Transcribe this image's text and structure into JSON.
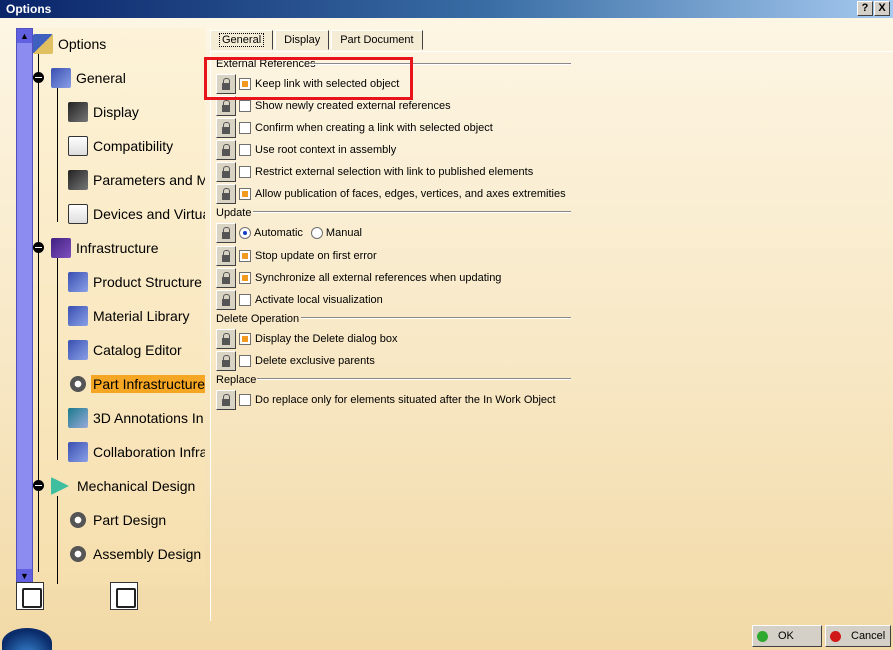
{
  "window": {
    "title": "Options",
    "help_label": "?",
    "close_label": "X"
  },
  "tree": {
    "items": [
      {
        "label": "Options",
        "icon": "options-icon"
      },
      {
        "label": "General",
        "icon": "general-icon"
      },
      {
        "label": "Display",
        "icon": "display-icon"
      },
      {
        "label": "Compatibility",
        "icon": "compatibility-icon"
      },
      {
        "label": "Parameters and Me",
        "icon": "parameters-icon"
      },
      {
        "label": "Devices and Virtua",
        "icon": "devices-icon"
      },
      {
        "label": "Infrastructure",
        "icon": "infrastructure-icon"
      },
      {
        "label": "Product Structure",
        "icon": "product-structure-icon"
      },
      {
        "label": "Material Library",
        "icon": "material-library-icon"
      },
      {
        "label": "Catalog Editor",
        "icon": "catalog-editor-icon"
      },
      {
        "label": "Part Infrastructure",
        "icon": "gear-icon"
      },
      {
        "label": "3D Annotations In",
        "icon": "annotations-icon"
      },
      {
        "label": "Collaboration Infra",
        "icon": "collaboration-icon"
      },
      {
        "label": "Mechanical Design",
        "icon": "mechanical-design-icon"
      },
      {
        "label": "Part Design",
        "icon": "part-design-icon"
      },
      {
        "label": "Assembly Design",
        "icon": "assembly-design-icon"
      }
    ],
    "selected": "Part Infrastructure",
    "scroll_up": "▲",
    "scroll_down": "▼"
  },
  "tabs": [
    "General",
    "Display",
    "Part Document"
  ],
  "sections": {
    "external_references": {
      "title": "External References",
      "options": [
        {
          "label": "Keep link with selected object",
          "checked": true
        },
        {
          "label": "Show newly created external references",
          "checked": false
        },
        {
          "label": "Confirm when creating a link with selected object",
          "checked": false
        },
        {
          "label": "Use root context in assembly",
          "checked": false
        },
        {
          "label": "Restrict external selection with link to published elements",
          "checked": false
        },
        {
          "label": "Allow publication of faces, edges, vertices, and axes extremities",
          "checked": true
        }
      ]
    },
    "update": {
      "title": "Update",
      "radio_automatic": "Automatic",
      "radio_manual": "Manual",
      "selected_mode": "Automatic",
      "options": [
        {
          "label": "Stop update on first error",
          "checked": true
        },
        {
          "label": "Synchronize all external references when updating",
          "checked": true
        },
        {
          "label": "Activate local visualization",
          "checked": false
        }
      ]
    },
    "delete_operation": {
      "title": "Delete Operation",
      "options": [
        {
          "label": "Display the Delete dialog box",
          "checked": true
        },
        {
          "label": "Delete exclusive parents",
          "checked": false
        }
      ]
    },
    "replace": {
      "title": "Replace",
      "options": [
        {
          "label": "Do replace only for elements situated after the In Work Object",
          "checked": false
        }
      ]
    }
  },
  "footer": {
    "ok_label": "OK",
    "cancel_label": "Cancel"
  },
  "colors": {
    "accent": "#f5a623",
    "highlight_box": "#e8141c",
    "ok_dot": "#2fa82f",
    "cancel_dot": "#d01818"
  }
}
